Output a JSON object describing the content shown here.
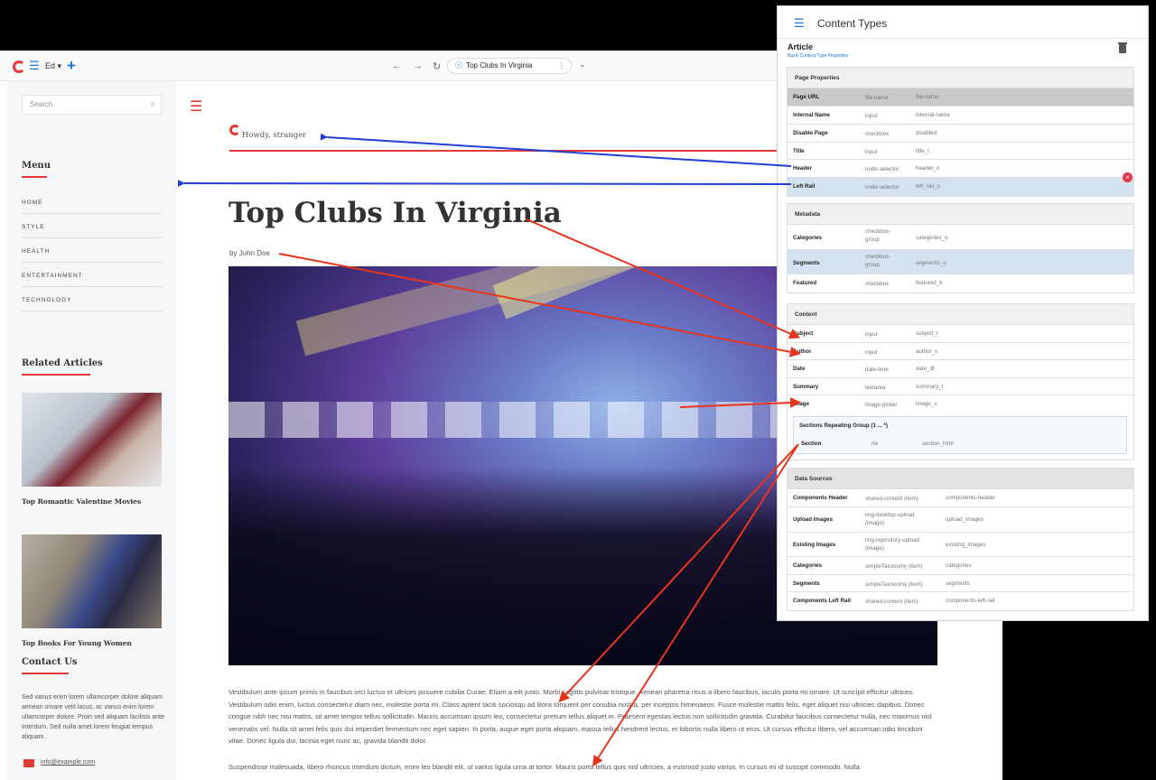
{
  "browser": {
    "site": "Ed",
    "site_caret": "▾",
    "menu_glyph": "☰",
    "plus_glyph": "+",
    "back_glyph": "←",
    "forward_glyph": "→",
    "reload_glyph": "↻",
    "url_label": "Top Clubs In Virginia",
    "info_glyph": "ⓘ",
    "dots_glyph": "⋮",
    "chevron_glyph": "⌄"
  },
  "sidebar": {
    "search_placeholder": "Search",
    "search_icon": "⌕",
    "menu_heading": "Menu",
    "menu_items": [
      "HOME",
      "STYLE",
      "HEALTH",
      "ENTERTAINMENT",
      "TECHNOLOGY"
    ],
    "related_heading": "Related Articles",
    "related": [
      {
        "title": "Top Romantic Valentine Movies"
      },
      {
        "title": "Top Books For Young Women"
      }
    ],
    "contact_heading": "Contact Us",
    "contact_text": "Sed varius enim lorem ullamcorper dolore aliquam aenean ornare velit lacus, ac varius enim lorem ullamcorper dolore. Proin sed aliquam facilisis ante interdum. Sed nulla amet lorem feugiat tempus aliquam.",
    "email": "info@example.com"
  },
  "article": {
    "hamburger_glyph": "☰",
    "greeting": "Howdy, stranger",
    "title": "Top Clubs In Virginia",
    "byline": "by John Doe",
    "paragraph1": "Vestibulum ante ipsum primis in faucibus orci luctus et ultrices posuere cubilia Curae; Etiam a elit justo. Morbi sagittis pulvinar tristique. Aenean pharetra risus a libero faucibus, iaculis porta mi ornare. Ut suscipit efficitur ultrices. Vestibulum odio enim, luctus consectetur diam nec, molestie porta mi. Class aptent taciti sociosqu ad litora torquent per conubia nostra, per inceptos himenaeos. Fusce molestie mattis felis, eget aliquet nisi ultricies dapibus. Donec congue nibh nec nisi mattis, sit amet tempor tellus sollicitudin. Mauris accumsan ipsum leo, consectetur pretium tellus aliquet in. Praesent egestas lectus non sollicitudin gravida. Curabitur faucibus consectetur nulla, nec maximus nisl venenatis vel. Nulla sit amet felis quis dui imperdiet fermentum nec eget sapien. In porta, augue eget porta aliquam, massa tellus hendrerit lectus, et lobortis nulla libero ut eros. Ut cursus efficitur libero, vel accumsan odio tincidunt vitae. Donec ligula dui, lacinia eget nunc ac, gravida blandit dolor.",
    "paragraph2": "Suspendisse malesuada, libero rhoncus interdum dictum, enim leo blandit elit, ut varius ligula urna at tortor. Mauris porta tellus quis nisl ultricies, a euismod justo varius. In cursus mi id suscipit commodo. Nulla"
  },
  "content_types": {
    "menu_glyph": "☰",
    "title": "Content Types",
    "type_name": "Article",
    "type_description": "Basic Content Type Properties",
    "sections": {
      "page_properties": {
        "label": "Page Properties",
        "rows": [
          {
            "name": "Page URL",
            "type": "file-name",
            "id": "file-name"
          },
          {
            "name": "Internal Name",
            "type": "input",
            "id": "internal-name"
          },
          {
            "name": "Disable Page",
            "type": "checkbox",
            "id": "disabled"
          },
          {
            "name": "Title",
            "type": "input",
            "id": "title_t"
          },
          {
            "name": "Header",
            "type": "node-selector",
            "id": "header_o"
          },
          {
            "name": "Left Rail",
            "type": "node-selector",
            "id": "left_rail_o"
          }
        ]
      },
      "metadata": {
        "label": "Metadata",
        "rows": [
          {
            "name": "Categories",
            "type": "checkbox-group",
            "id": "categories_o"
          },
          {
            "name": "Segments",
            "type": "checkbox-group",
            "id": "segments_o"
          },
          {
            "name": "Featured",
            "type": "checkbox",
            "id": "featured_b"
          }
        ]
      },
      "content": {
        "label": "Content",
        "rows": [
          {
            "name": "Subject",
            "type": "input",
            "id": "subject_t"
          },
          {
            "name": "Author",
            "type": "input",
            "id": "author_s"
          },
          {
            "name": "Date",
            "type": "date-time",
            "id": "date_dt"
          },
          {
            "name": "Summary",
            "type": "textarea",
            "id": "summary_t"
          },
          {
            "name": "Image",
            "type": "image-picker",
            "id": "image_s"
          }
        ],
        "repeat_group": {
          "label": "Sections Repeating Group (1 ... *)",
          "row": {
            "name": "Section",
            "type": "rte",
            "id": "section_html"
          }
        }
      },
      "data_sources": {
        "label": "Data Sources",
        "rows": [
          {
            "name": "Components Header",
            "type": "shared-content (item)",
            "id": "components-header"
          },
          {
            "name": "Upload Images",
            "type": "img-desktop-upload (image)",
            "id": "upload_images"
          },
          {
            "name": "Existing Images",
            "type": "img-repository-upload (image)",
            "id": "existing_images"
          },
          {
            "name": "Categories",
            "type": "simpleTaxonomy (item)",
            "id": "categories"
          },
          {
            "name": "Segments",
            "type": "simpleTaxonomy (item)",
            "id": "segments"
          },
          {
            "name": "Components Left Rail",
            "type": "shared-content (item)",
            "id": "components-left-rail"
          }
        ]
      }
    },
    "remove_glyph": "×"
  },
  "colors": {
    "accent_red": "#e53935",
    "link_blue": "#1976d2",
    "arrow_blue": "#1f3fd6",
    "arrow_red": "#e8341c"
  },
  "icons": [
    "crafter-logo-icon",
    "hamburger-icon",
    "plus-icon",
    "search-icon",
    "mail-icon",
    "trash-icon",
    "remove-icon"
  ]
}
